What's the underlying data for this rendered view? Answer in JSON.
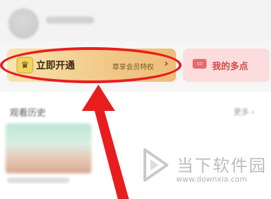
{
  "vip_card": {
    "open_label": "立即开通",
    "privilege_label": "尊享会员特权",
    "chevron": "›",
    "icon": "crown-icon"
  },
  "points_card": {
    "label": "我的多点",
    "icon": "ticket-icon"
  },
  "history": {
    "title": "观看历史",
    "more": "更多 ›"
  },
  "annotation": {
    "color": "#e81d1d"
  },
  "watermark": {
    "text": "当下软件园",
    "url": "www.downxia.com"
  }
}
